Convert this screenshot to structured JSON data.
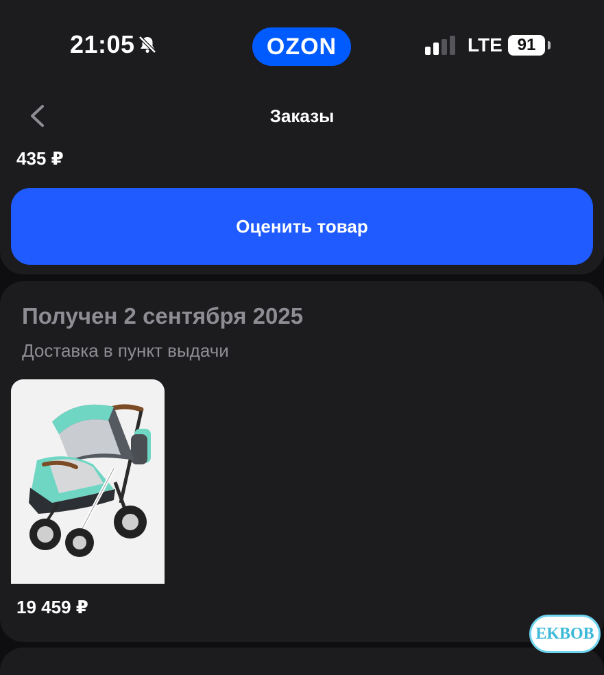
{
  "status_bar": {
    "time": "21:05",
    "network": "LTE",
    "battery": "91",
    "icons": [
      "bell-muted-icon",
      "signal-icon"
    ]
  },
  "logo": {
    "text": "OZON",
    "color": "#005bff"
  },
  "header": {
    "title": "Заказы",
    "back_icon": "chevron-left-icon"
  },
  "previous_order": {
    "price": "435 ₽",
    "rate_button_label": "Оценить товар"
  },
  "order": {
    "status": "Получен 2 сентября 2025",
    "delivery_method": "Доставка в пункт выдачи",
    "items": [
      {
        "image": "stroller-image",
        "price": "19 459 ₽"
      }
    ]
  },
  "watermark": {
    "text": "EKBOB"
  },
  "colors": {
    "background": "#0e0e10",
    "card": "#1c1c1f",
    "accent": "#1f5bff",
    "secondary_text": "#8d8d93"
  }
}
